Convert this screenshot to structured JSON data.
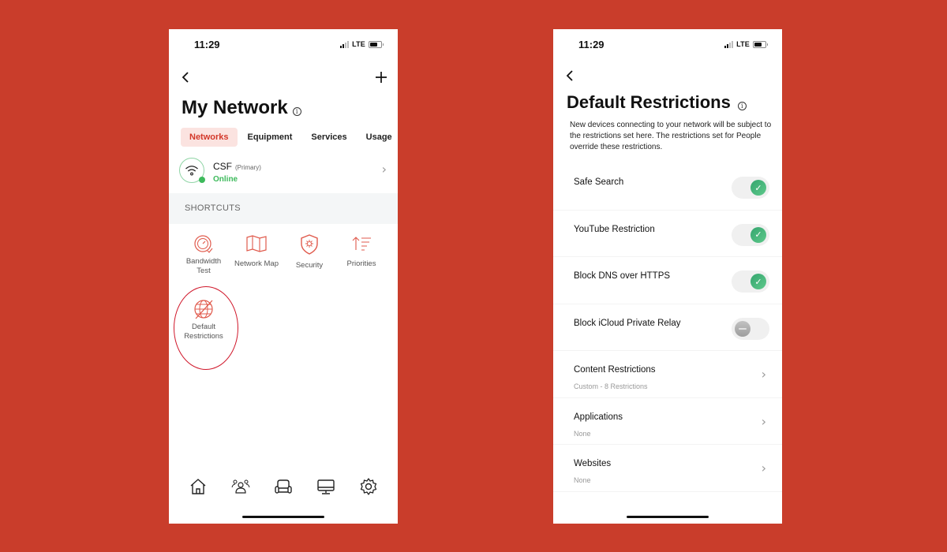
{
  "background_color": "#c93d2b",
  "accent_color": "#d3382a",
  "success_color": "#3dba5b",
  "phone1": {
    "status_bar": {
      "time": "11:29",
      "network": "LTE"
    },
    "header": {
      "back_icon": "chevron-left-icon",
      "add_icon": "plus-icon",
      "title": "My Network",
      "info_icon": "info-icon"
    },
    "tabs": [
      {
        "label": "Networks",
        "active": true
      },
      {
        "label": "Equipment",
        "active": false
      },
      {
        "label": "Services",
        "active": false
      },
      {
        "label": "Usage",
        "active": false
      }
    ],
    "network": {
      "name": "CSF",
      "tag": "(Primary)",
      "status": "Online",
      "icon": "wifi-icon"
    },
    "shortcuts_title": "SHORTCUTS",
    "shortcuts": [
      {
        "label_line1": "Bandwidth",
        "label_line2": "Test",
        "icon": "speedometer-icon"
      },
      {
        "label_line1": "Network Map",
        "label_line2": "",
        "icon": "map-icon"
      },
      {
        "label_line1": "Security",
        "label_line2": "",
        "icon": "shield-icon"
      },
      {
        "label_line1": "Priorities",
        "label_line2": "",
        "icon": "priorities-icon"
      },
      {
        "label_line1": "Default",
        "label_line2": "Restrictions",
        "icon": "globe-restricted-icon",
        "highlighted": true
      }
    ],
    "bottom_nav": [
      {
        "name": "home",
        "icon": "home-icon"
      },
      {
        "name": "people",
        "icon": "people-icon"
      },
      {
        "name": "places",
        "icon": "sofa-icon"
      },
      {
        "name": "devices",
        "icon": "monitor-icon"
      },
      {
        "name": "settings",
        "icon": "gear-icon"
      }
    ]
  },
  "phone2": {
    "status_bar": {
      "time": "11:29",
      "network": "LTE"
    },
    "header": {
      "back_icon": "chevron-left-icon",
      "title": "Default Restrictions",
      "info_icon": "info-icon"
    },
    "description": "New devices connecting to your network will be subject to the restrictions set here. The restrictions set for People override these restrictions.",
    "toggles": [
      {
        "label": "Safe Search",
        "enabled": true
      },
      {
        "label": "YouTube Restriction",
        "enabled": true
      },
      {
        "label": "Block DNS over HTTPS",
        "enabled": true
      },
      {
        "label": "Block iCloud Private Relay",
        "enabled": false
      }
    ],
    "links": [
      {
        "label": "Content Restrictions",
        "value": "Custom - 8 Restrictions"
      },
      {
        "label": "Applications",
        "value": "None"
      },
      {
        "label": "Websites",
        "value": "None"
      }
    ]
  }
}
